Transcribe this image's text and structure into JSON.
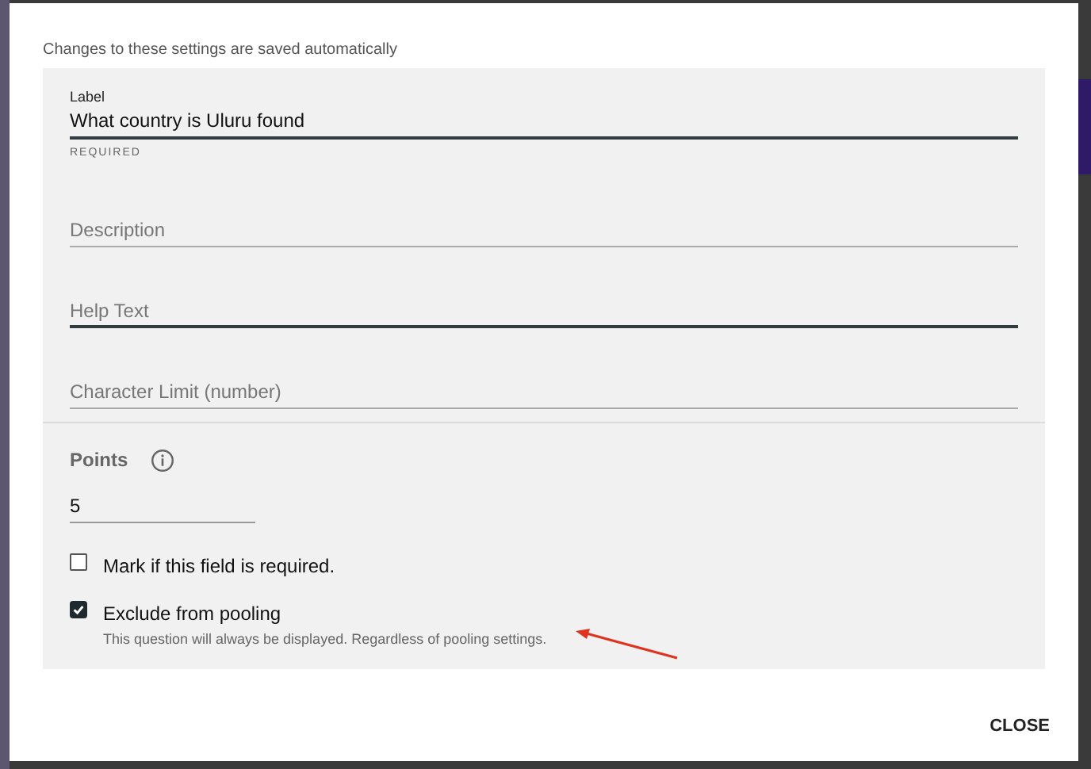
{
  "notice": "Changes to these settings are saved automatically",
  "fields": [
    {
      "label": "Label",
      "value": "What country is Uluru found",
      "helper": "REQUIRED",
      "focused": true
    },
    {
      "placeholder": "Description",
      "focused": false
    },
    {
      "placeholder": "Help Text",
      "focused": true
    },
    {
      "placeholder": "Character Limit (number)",
      "focused": false
    }
  ],
  "points": {
    "label": "Points",
    "value": "5"
  },
  "checkboxes": [
    {
      "label": "Mark if this field is required.",
      "checked": false
    },
    {
      "label": "Exclude from pooling",
      "hint": "This question will always be displayed. Regardless of pooling settings.",
      "checked": true
    }
  ],
  "buttons": [
    "CLOSE"
  ]
}
